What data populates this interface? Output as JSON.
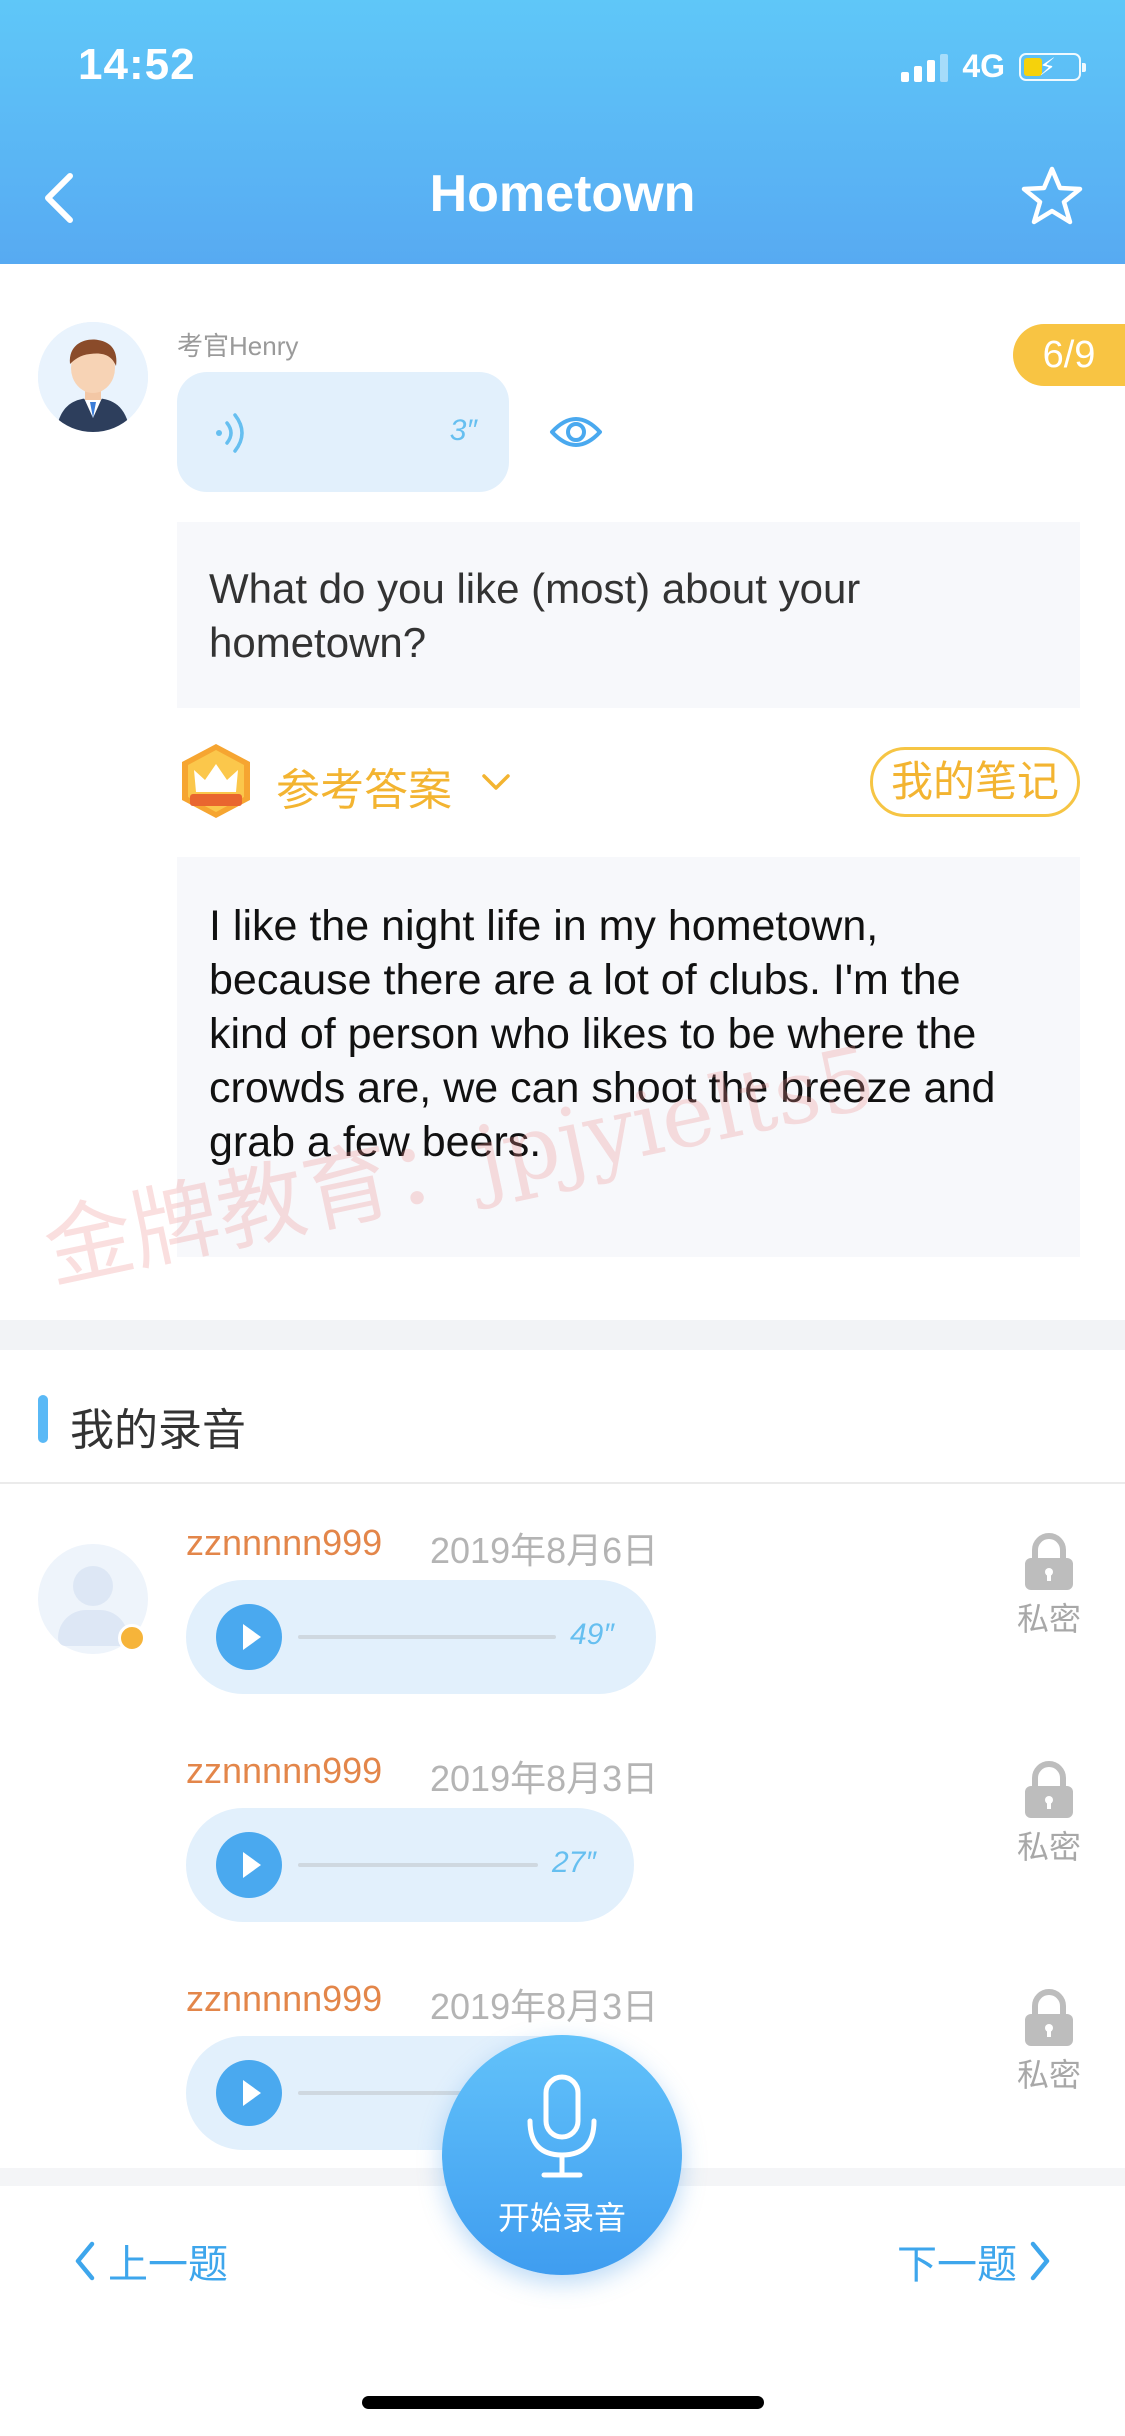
{
  "status_bar": {
    "time": "14:52",
    "network": "4G"
  },
  "header": {
    "title": "Hometown"
  },
  "question": {
    "examiner_name": "考官Henry",
    "progress": "6/9",
    "audio_duration": "3″",
    "text": "What do you like (most) about your hometown?"
  },
  "reference": {
    "label": "参考答案",
    "notes_label": "我的笔记",
    "answer_text": "I like the night life in my hometown, because there are a lot of clubs. I'm the kind of person who likes to be where the crowds are, we can shoot the breeze and grab a few beers.",
    "watermark": "金牌教育：jpjyielts5"
  },
  "recordings": {
    "title": "我的录音",
    "items": [
      {
        "user": "zznnnnn999",
        "date": "2019年8月6日",
        "duration": "49″",
        "privacy": "私密"
      },
      {
        "user": "zznnnnn999",
        "date": "2019年8月3日",
        "duration": "27″",
        "privacy": "私密"
      },
      {
        "user": "zznnnnn999",
        "date": "2019年8月3日",
        "duration": "",
        "privacy": "私密"
      }
    ]
  },
  "bottom": {
    "prev_label": "上一题",
    "next_label": "下一题",
    "record_label": "开始录音"
  },
  "colors": {
    "header_gradient_top": "#5fc7f8",
    "header_gradient_bottom": "#57aaf2",
    "accent_blue": "#4aa9ef",
    "gold": "#f3b431",
    "username_orange": "#e3864a"
  },
  "icons": [
    "back-chevron-icon",
    "star-icon",
    "sound-wave-icon",
    "eye-icon",
    "crown-icon",
    "chevron-down-icon",
    "play-icon",
    "lock-icon",
    "microphone-icon"
  ]
}
